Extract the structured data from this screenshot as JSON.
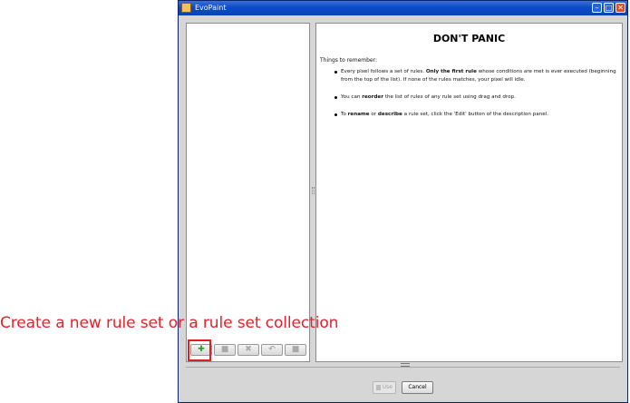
{
  "window": {
    "title": "EvoPaint",
    "controls": {
      "minimize": "–",
      "maximize": "□",
      "close": "✕"
    }
  },
  "description_panel": {
    "heading": "DON'T PANIC",
    "intro": "Things to remember:",
    "bullets": [
      {
        "before": "Every pixel follows a set of rules. ",
        "bold": "Only the first rule",
        "after": " whose conditions are met is ever executed (beginning from the top of the list). If none of the rules matches, your pixel will idle."
      },
      {
        "before": "You can ",
        "bold": "reorder",
        "after": " the list of rules of any rule set using drag and drop."
      },
      {
        "before": "To ",
        "bold": "rename",
        "middle": " or ",
        "bold2": "describe",
        "after": " a rule set, click the 'Edit' button of the description panel."
      }
    ]
  },
  "toolbar": {
    "icons": [
      "add-icon",
      "copy-icon",
      "delete-icon",
      "import-icon",
      "export-icon"
    ]
  },
  "dialog_buttons": {
    "use": "Use",
    "cancel": "Cancel"
  },
  "annotation": {
    "text": "Create a new rule set or a rule set collection",
    "color": "#e5202a"
  }
}
